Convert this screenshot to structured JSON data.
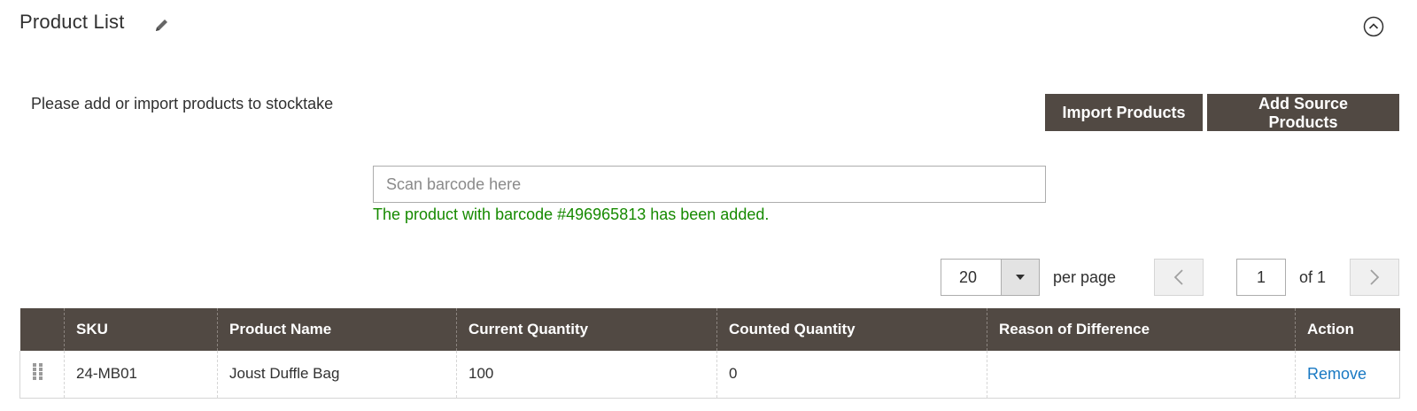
{
  "section": {
    "title": "Product List",
    "edit_icon": "pencil-icon",
    "collapse_icon": "chevron-up-circle-icon"
  },
  "hint": "Please add or import products to stocktake",
  "buttons": {
    "import": "Import Products",
    "add_source": "Add Source Products"
  },
  "scan": {
    "placeholder": "Scan barcode here",
    "value": "",
    "message": "The product with barcode #496965813 has been added.",
    "message_color": "#168a00"
  },
  "pager": {
    "page_size": "20",
    "per_page_label": "per page",
    "current_page": "1",
    "of_label": "of 1"
  },
  "table": {
    "columns": [
      "",
      "SKU",
      "Product Name",
      "Current Quantity",
      "Counted Quantity",
      "Reason of Difference",
      "Action"
    ],
    "rows": [
      {
        "sku": "24-MB01",
        "name": "Joust Duffle Bag",
        "current_qty": "100",
        "counted_qty": "0",
        "reason": "",
        "action": "Remove"
      }
    ]
  },
  "colors": {
    "header_bg": "#514943",
    "button_bg": "#514943",
    "link": "#1979c3",
    "success": "#168a00"
  }
}
